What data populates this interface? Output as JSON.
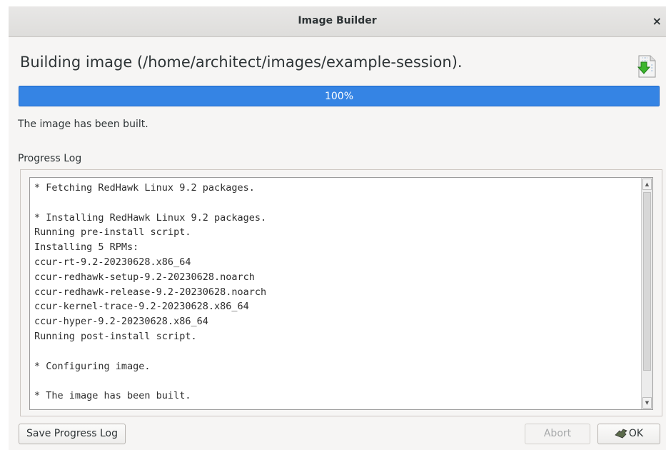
{
  "window": {
    "title": "Image Builder",
    "close_label": "×"
  },
  "header": {
    "text": "Building image (/home/architect/images/example-session)."
  },
  "progress": {
    "value": 1.0,
    "label": "100%",
    "fill_color": "#3584e4"
  },
  "status_text": "The image has been built.",
  "log": {
    "label": "Progress Log",
    "lines": [
      "* Fetching RedHawk Linux 9.2 packages.",
      "",
      "* Installing RedHawk Linux 9.2 packages.",
      "Running pre-install script.",
      "Installing 5 RPMs:",
      "ccur-rt-9.2-20230628.x86_64",
      "ccur-redhawk-setup-9.2-20230628.noarch",
      "ccur-redhawk-release-9.2-20230628.noarch",
      "ccur-kernel-trace-9.2-20230628.x86_64",
      "ccur-hyper-9.2-20230628.x86_64",
      "Running post-install script.",
      "",
      "* Configuring image.",
      "",
      "* The image has been built."
    ]
  },
  "buttons": {
    "save_log": "Save Progress Log",
    "abort": "Abort",
    "ok": "OK"
  },
  "icons": {
    "build": "download-document-icon",
    "ok": "ok-hand-icon"
  }
}
